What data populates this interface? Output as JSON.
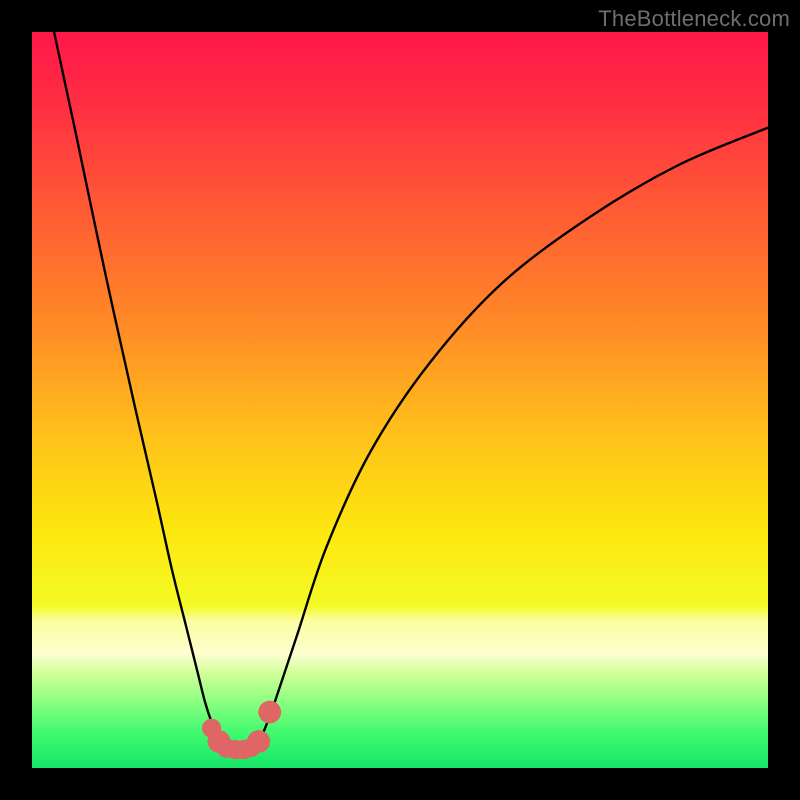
{
  "watermark": "TheBottleneck.com",
  "chart_data": {
    "type": "line",
    "title": "",
    "xlabel": "",
    "ylabel": "",
    "xlim": [
      0,
      100
    ],
    "ylim": [
      0,
      100
    ],
    "series": [
      {
        "name": "left-branch",
        "x": [
          3,
          6,
          10,
          14,
          17,
          19,
          21,
          22.5,
          23.5,
          24.5,
          25.5,
          26.5
        ],
        "values": [
          100,
          86,
          67,
          49,
          36,
          27,
          19,
          13,
          9,
          6,
          4,
          3
        ]
      },
      {
        "name": "right-branch",
        "x": [
          30.5,
          31.5,
          33,
          36,
          40,
          46,
          54,
          64,
          76,
          88,
          100
        ],
        "values": [
          3,
          5,
          9,
          18,
          30,
          43,
          55,
          66,
          75,
          82,
          87
        ]
      }
    ],
    "markers": {
      "name": "bottom-markers",
      "color": "#e06666",
      "points": [
        {
          "x": 24.4,
          "y": 5.4,
          "r": 1.3
        },
        {
          "x": 25.4,
          "y": 3.6,
          "r": 1.55
        },
        {
          "x": 26.4,
          "y": 2.7,
          "r": 1.3
        },
        {
          "x": 27.6,
          "y": 2.5,
          "r": 1.3
        },
        {
          "x": 28.8,
          "y": 2.5,
          "r": 1.3
        },
        {
          "x": 29.8,
          "y": 2.8,
          "r": 1.3
        },
        {
          "x": 30.8,
          "y": 3.6,
          "r": 1.55
        },
        {
          "x": 32.3,
          "y": 7.6,
          "r": 1.55
        }
      ]
    },
    "gradient_stops": [
      {
        "offset": 0,
        "color": "#ff1749"
      },
      {
        "offset": 0.1,
        "color": "#ff2f42"
      },
      {
        "offset": 0.24,
        "color": "#ff5a34"
      },
      {
        "offset": 0.4,
        "color": "#ff8b26"
      },
      {
        "offset": 0.55,
        "color": "#ffc21a"
      },
      {
        "offset": 0.68,
        "color": "#fde80e"
      },
      {
        "offset": 0.78,
        "color": "#f4fa26"
      },
      {
        "offset": 0.8,
        "color": "#fbfea0"
      },
      {
        "offset": 0.845,
        "color": "#fcffd0"
      },
      {
        "offset": 0.87,
        "color": "#d2ff9a"
      },
      {
        "offset": 0.91,
        "color": "#8bff80"
      },
      {
        "offset": 0.955,
        "color": "#3cf96e"
      },
      {
        "offset": 1.0,
        "color": "#17e56a"
      }
    ]
  }
}
